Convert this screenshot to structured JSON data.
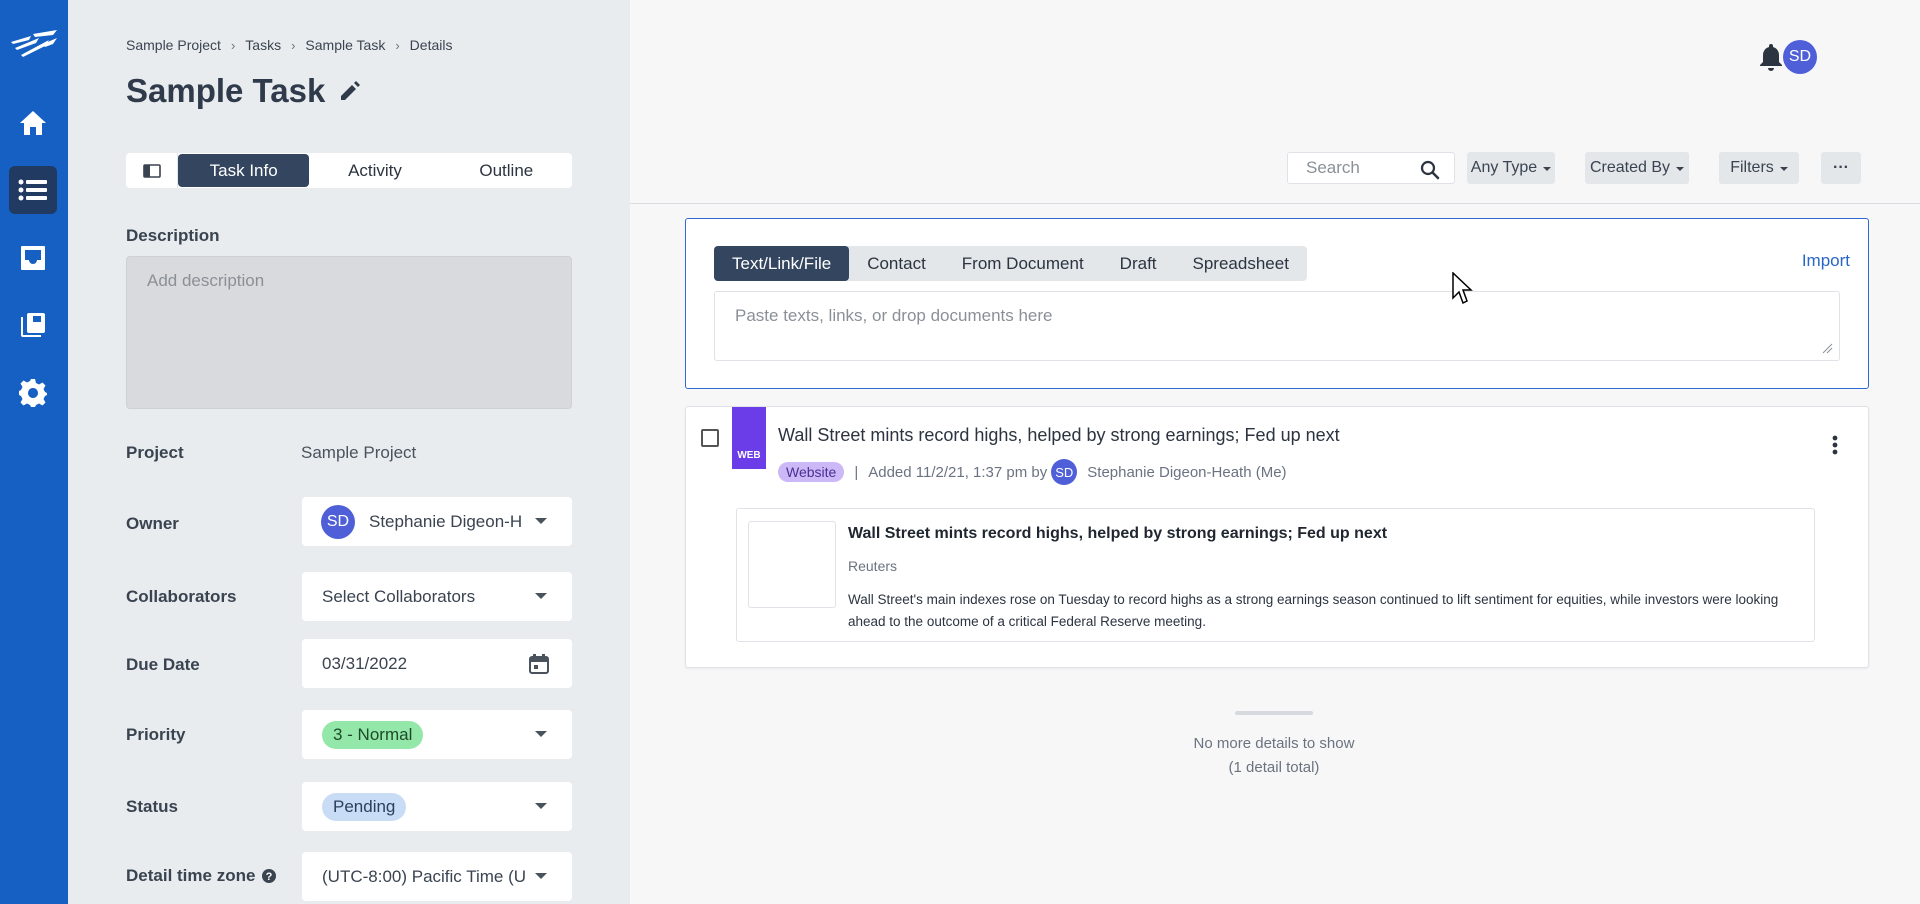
{
  "app": {
    "nav": [
      "home",
      "tasks",
      "inbox",
      "library",
      "settings"
    ]
  },
  "breadcrumb": [
    "Sample Project",
    "Tasks",
    "Sample Task",
    "Details"
  ],
  "page_title": "Sample Task",
  "tabs": [
    "Task Info",
    "Activity",
    "Outline"
  ],
  "active_tab": "Task Info",
  "form": {
    "description_label": "Description",
    "description_placeholder": "Add description",
    "project_label": "Project",
    "project_value": "Sample Project",
    "owner_label": "Owner",
    "owner_initials": "SD",
    "owner_value": "Stephanie Digeon-H",
    "collaborators_label": "Collaborators",
    "collaborators_placeholder": "Select Collaborators",
    "due_date_label": "Due Date",
    "due_date_value": "03/31/2022",
    "priority_label": "Priority",
    "priority_value": "3 - Normal",
    "status_label": "Status",
    "status_value": "Pending",
    "timezone_label": "Detail time zone",
    "timezone_value": "(UTC-8:00) Pacific Time (U"
  },
  "top": {
    "user_initials": "SD",
    "search_placeholder": "Search",
    "filters": [
      "Any Type",
      "Created By",
      "Filters"
    ],
    "more_label": "···"
  },
  "input_card": {
    "source_tabs": [
      "Text/Link/File",
      "Contact",
      "From Document",
      "Draft",
      "Spreadsheet"
    ],
    "active_source": "Text/Link/File",
    "import_label": "Import",
    "paste_placeholder": "Paste texts, links, or drop documents here"
  },
  "detail": {
    "badge": "WEB",
    "title": "Wall Street mints record highs, helped by strong earnings; Fed up next",
    "tag": "Website",
    "separator": "|",
    "added": "Added  11/2/21, 1:37 pm by",
    "author_initials": "SD",
    "author": "Stephanie Digeon-Heath (Me)",
    "preview": {
      "title": "Wall Street mints record highs, helped by strong earnings; Fed up next",
      "source": "Reuters",
      "body": "Wall Street's main indexes rose on Tuesday to record highs as a strong earnings season continued to lift sentiment for equities, while investors were looking ahead to the outcome of a critical Federal Reserve meeting."
    }
  },
  "footer": {
    "line1": "No more details to show",
    "line2": "(1 detail total)"
  },
  "colors": {
    "nav_bg": "#1560c2",
    "active_tab": "#34465f",
    "priority_pill": "#93e7a8",
    "status_pill": "#c9dcf5",
    "web_badge": "#6a3de8",
    "avatar": "#4e5fd8"
  }
}
